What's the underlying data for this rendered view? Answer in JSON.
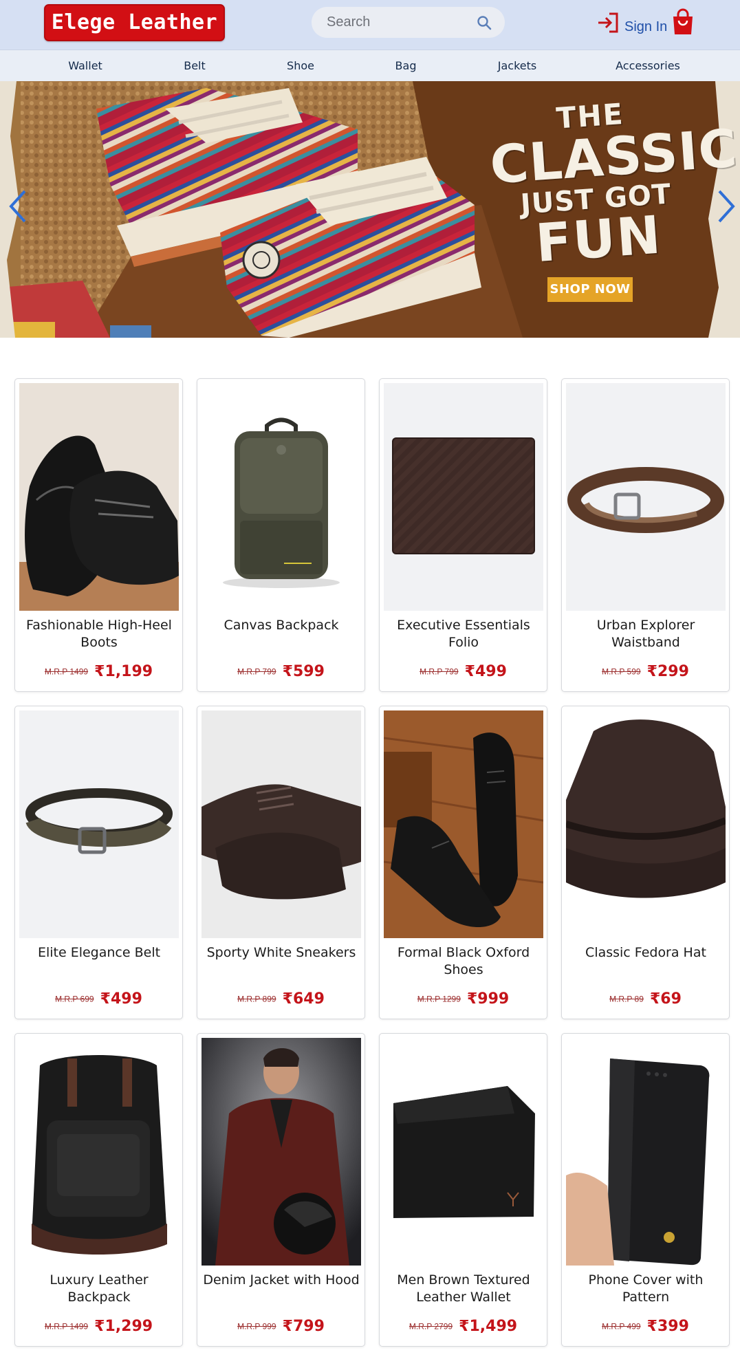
{
  "header": {
    "logo_text": "Elege Leather",
    "search": {
      "placeholder": "Search"
    },
    "signin_label": "Sign In"
  },
  "nav": {
    "items": [
      {
        "label": "Wallet"
      },
      {
        "label": "Belt"
      },
      {
        "label": "Shoe"
      },
      {
        "label": "Bag"
      },
      {
        "label": "Jackets"
      },
      {
        "label": "Accessories"
      }
    ]
  },
  "hero": {
    "line1": "THE",
    "line2": "CLASSIC",
    "line3": "JUST GOT",
    "line4": "FUN",
    "cta": "SHOP NOW",
    "prev_icon": "chevron-left-icon",
    "next_icon": "chevron-right-icon"
  },
  "products": [
    {
      "name": "Fashionable High-Heel Boots",
      "mrp": "M.R.P 1499",
      "price": "₹1,199",
      "image": "black-formal-shoes"
    },
    {
      "name": "Canvas Backpack",
      "mrp": "M.R.P 799",
      "price": "₹599",
      "image": "olive-backpack"
    },
    {
      "name": "Executive Essentials Folio",
      "mrp": "M.R.P 799",
      "price": "₹499",
      "image": "brown-wallet"
    },
    {
      "name": "Urban Explorer Waistband",
      "mrp": "M.R.P 599",
      "price": "₹299",
      "image": "brown-belt"
    },
    {
      "name": "Elite Elegance Belt",
      "mrp": "M.R.P 699",
      "price": "₹499",
      "image": "olive-belt"
    },
    {
      "name": "Sporty White Sneakers",
      "mrp": "M.R.P 899",
      "price": "₹649",
      "image": "brown-derby-shoes"
    },
    {
      "name": "Formal Black Oxford Shoes",
      "mrp": "M.R.P 1299",
      "price": "₹999",
      "image": "black-oxford-shoes"
    },
    {
      "name": "Classic Fedora Hat",
      "mrp": "M.R.P 89",
      "price": "₹69",
      "image": "leather-hat"
    },
    {
      "name": "Luxury Leather Backpack",
      "mrp": "M.R.P 1499",
      "price": "₹1,299",
      "image": "black-leather-backpack"
    },
    {
      "name": "Denim Jacket with Hood",
      "mrp": "M.R.P 999",
      "price": "₹799",
      "image": "leather-jacket-man"
    },
    {
      "name": "Men Brown Textured Leather Wallet",
      "mrp": "M.R.P 2799",
      "price": "₹1,499",
      "image": "black-wallet"
    },
    {
      "name": "Phone Cover with Pattern",
      "mrp": "M.R.P 499",
      "price": "₹399",
      "image": "phone-cover"
    }
  ],
  "colors": {
    "brand_red": "#d20f14",
    "header_bg": "#d6e0f3",
    "signin_blue": "#1f4fa8",
    "price_red": "#c4141a",
    "cta_yellow": "#e5a427"
  }
}
